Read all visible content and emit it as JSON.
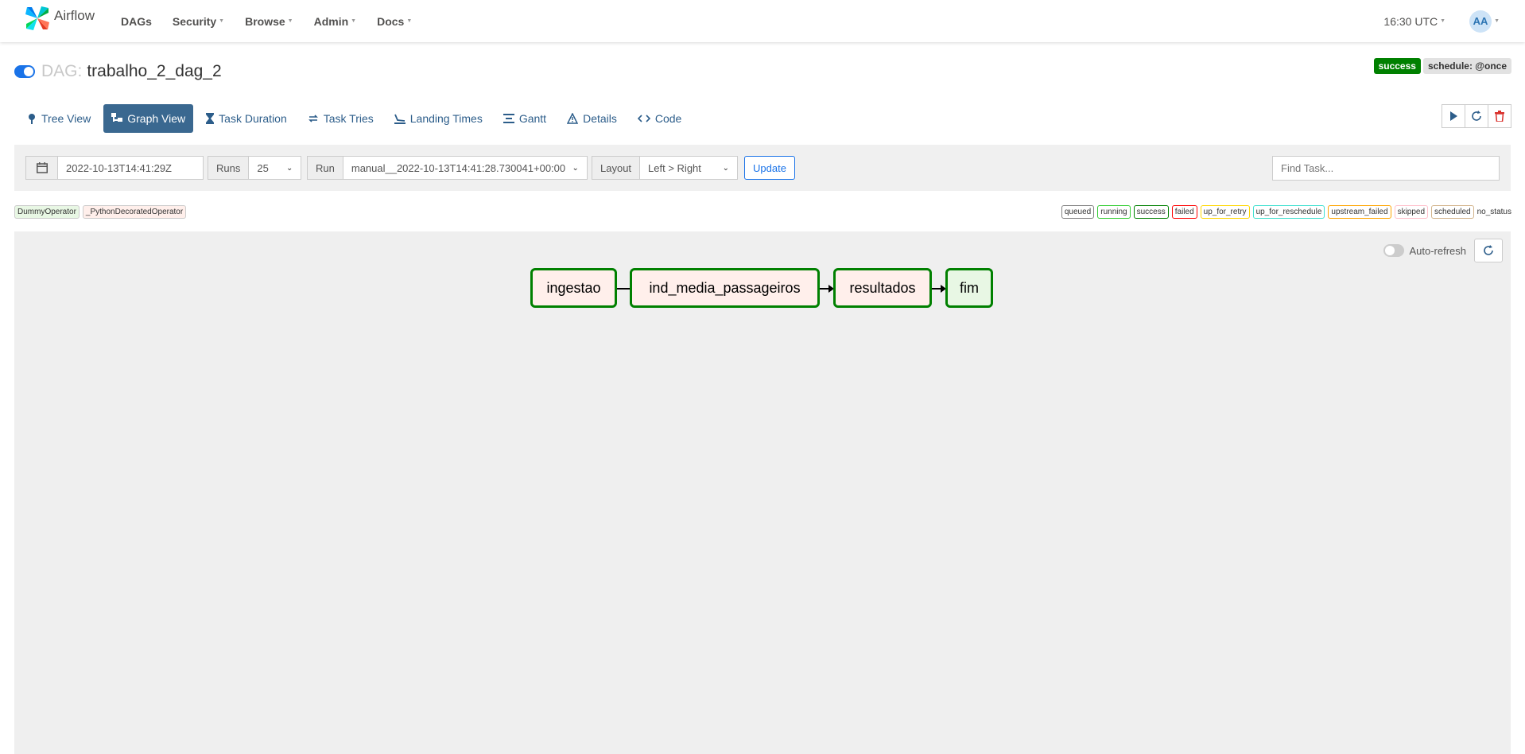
{
  "navbar": {
    "brand": "Airflow",
    "menu": [
      "DAGs",
      "Security",
      "Browse",
      "Admin",
      "Docs"
    ],
    "clock": "16:30 UTC",
    "user_initials": "AA"
  },
  "dag": {
    "prefix": "DAG:",
    "id": "trabalho_2_dag_2",
    "state": "success",
    "schedule": "schedule: @once"
  },
  "tabs": [
    {
      "label": "Tree View",
      "icon": "tree-icon"
    },
    {
      "label": "Graph View",
      "icon": "graph-icon",
      "active": true
    },
    {
      "label": "Task Duration",
      "icon": "hourglass-icon"
    },
    {
      "label": "Task Tries",
      "icon": "retry-icon"
    },
    {
      "label": "Landing Times",
      "icon": "landing-icon"
    },
    {
      "label": "Gantt",
      "icon": "gantt-icon"
    },
    {
      "label": "Details",
      "icon": "warning-icon"
    },
    {
      "label": "Code",
      "icon": "code-icon"
    }
  ],
  "filters": {
    "base_date": "2022-10-13T14:41:29Z",
    "runs_label": "Runs",
    "runs_value": "25",
    "run_label": "Run",
    "run_value": "manual__2022-10-13T14:41:28.730041+00:00",
    "layout_label": "Layout",
    "layout_value": "Left > Right",
    "update_label": "Update",
    "find_placeholder": "Find Task..."
  },
  "operators": [
    {
      "name": "DummyOperator",
      "color": "#e8f7e4"
    },
    {
      "name": "_PythonDecoratedOperator",
      "color": "#ffefeb"
    }
  ],
  "states": [
    {
      "name": "queued",
      "color": "#808080"
    },
    {
      "name": "running",
      "color": "#32cd32"
    },
    {
      "name": "success",
      "color": "#008000"
    },
    {
      "name": "failed",
      "color": "#ff0000"
    },
    {
      "name": "up_for_retry",
      "color": "#ffd700"
    },
    {
      "name": "up_for_reschedule",
      "color": "#40e0d0"
    },
    {
      "name": "upstream_failed",
      "color": "#ffa500"
    },
    {
      "name": "skipped",
      "color": "#ffc0cb"
    },
    {
      "name": "scheduled",
      "color": "#d2b48c"
    },
    {
      "name": "no_status",
      "color": null
    }
  ],
  "graph": {
    "auto_refresh_label": "Auto-refresh",
    "nodes": [
      {
        "label": "ingestao",
        "color": "#ffefeb"
      },
      {
        "label": "ind_media_passageiros",
        "color": "#ffefeb"
      },
      {
        "label": "resultados",
        "color": "#ffefeb"
      },
      {
        "label": "fim",
        "color": "#e8f7e4"
      }
    ]
  }
}
